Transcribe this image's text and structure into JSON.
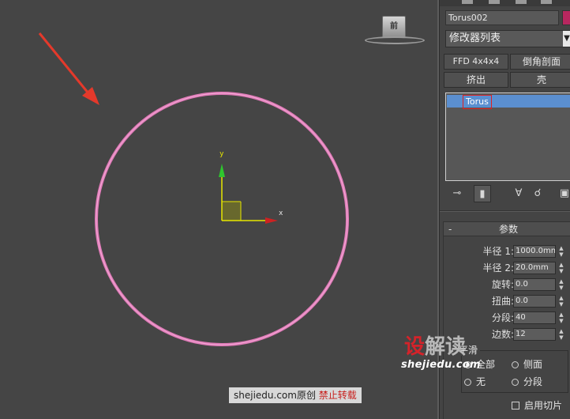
{
  "viewport": {
    "viewcube_label": "前",
    "axis_x": "x",
    "axis_y": "y",
    "watermark_site": "shejiedu.com原创",
    "watermark_notice": "禁止转载",
    "brand_cn": "设解读",
    "brand_url": "shejiedu.com",
    "colors": {
      "torus": "#e07ab8",
      "arrow": "#e4392b",
      "axis_y": "#2ec62e",
      "axis_x": "#cc2222"
    }
  },
  "panel": {
    "object_name": "Torus002",
    "object_color": "#b7275f",
    "modifier_list": "修改器列表",
    "buttons": {
      "ffd": "FFD 4x4x4",
      "chamfer": "倒角剖面",
      "extrude": "挤出",
      "shell": "壳"
    },
    "stack_items": [
      "Torus"
    ],
    "stack_icons": [
      "pin-stack-icon",
      "show-end-result-icon",
      "make-unique-icon",
      "remove-modifier-icon",
      "configure-modifier-sets-icon"
    ],
    "rollout_title": "参数",
    "params": [
      {
        "label": "半径 1:",
        "value": "1000.0mm"
      },
      {
        "label": "半径 2:",
        "value": "20.0mm"
      },
      {
        "label": "旋转:",
        "value": "0.0"
      },
      {
        "label": "扭曲:",
        "value": "0.0"
      },
      {
        "label": "分段:",
        "value": "40"
      },
      {
        "label": "边数:",
        "value": "12"
      }
    ],
    "smooth_group": {
      "title": "平滑",
      "options": [
        {
          "label": "全部",
          "selected": true
        },
        {
          "label": "侧面",
          "selected": false
        },
        {
          "label": "无",
          "selected": false
        },
        {
          "label": "分段",
          "selected": false
        }
      ]
    },
    "slice_on_label": "启用切片"
  }
}
